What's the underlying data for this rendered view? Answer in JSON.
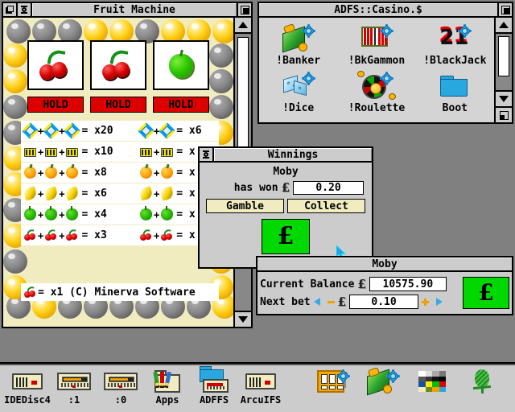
{
  "desktop": {
    "background": "#808080"
  },
  "fruit_machine": {
    "title": "Fruit Machine",
    "reels": [
      {
        "symbol": "cherry"
      },
      {
        "symbol": "cherry"
      },
      {
        "symbol": "apple"
      }
    ],
    "hold_buttons": [
      "HOLD",
      "HOLD",
      "HOLD"
    ],
    "hold_color": "#dd0000",
    "paytable": [
      {
        "symbol": "diamond",
        "three": "= x20",
        "two": "= x6"
      },
      {
        "symbol": "bar",
        "three": "= x10",
        "two": "= x"
      },
      {
        "symbol": "orange",
        "three": "= x8",
        "two": "= x"
      },
      {
        "symbol": "banana",
        "three": "= x6",
        "two": "= x"
      },
      {
        "symbol": "apple",
        "three": "= x4",
        "two": "= x"
      },
      {
        "symbol": "cherry",
        "three": "= x3",
        "two": "= x"
      }
    ],
    "credit_line": "= x1  (C) Minerva Software",
    "bulb_colors": {
      "on": "#ffd21a",
      "off": "#8a8a8a"
    },
    "bulbs_top": [
      "off",
      "off",
      "off",
      "on",
      "on",
      "off",
      "on",
      "on",
      "on"
    ],
    "bulbs_bottom": [
      "off",
      "on",
      "off",
      "off",
      "off",
      "off",
      "off",
      "off",
      "on"
    ],
    "bulbs_left": [
      "on",
      "on",
      "off",
      "off",
      "on",
      "on",
      "off",
      "on",
      "off",
      "on"
    ],
    "bulbs_right": [
      "off",
      "off",
      "off",
      "on",
      "off",
      "off",
      "on",
      "on",
      "on",
      "on"
    ],
    "panel_color": "#f0ecc0"
  },
  "casino": {
    "title": "ADFS::Casino.$",
    "files": [
      {
        "label": "!Banker",
        "icon": "banker-app-icon"
      },
      {
        "label": "!BkGammon",
        "icon": "backgammon-app-icon"
      },
      {
        "label": "!BlackJack",
        "icon": "blackjack-app-icon"
      },
      {
        "label": "!Dice",
        "icon": "dice-app-icon"
      },
      {
        "label": "!Roulette",
        "icon": "roulette-app-icon"
      },
      {
        "label": "Boot",
        "icon": "folder-icon"
      }
    ]
  },
  "winnings": {
    "title": "Winnings",
    "player": "Moby",
    "won_label": "has won",
    "currency": "£",
    "won_value": "0.20",
    "gamble_label": "Gamble",
    "collect_label": "Collect",
    "coin_color": "#00d800"
  },
  "moby": {
    "title": "Moby",
    "balance_label": "Current Balance",
    "currency": "£",
    "balance_value": "10575.90",
    "bet_label": "Next bet",
    "bet_value": "0.10",
    "coin_color": "#00d800"
  },
  "iconbar": {
    "left_items": [
      {
        "label": "IDEDisc4",
        "icon": "harddisc-icon"
      },
      {
        "label": ":1",
        "icon": "floppy-drive-icon"
      },
      {
        "label": ":0",
        "icon": "floppy-drive-icon"
      },
      {
        "label": "Apps",
        "icon": "apps-folder-icon"
      },
      {
        "label": "ADFFS",
        "icon": "adffs-icon"
      },
      {
        "label": "ArcuIFS",
        "icon": "harddisc-icon"
      }
    ],
    "right_items": [
      {
        "label": "",
        "icon": "fruit-machine-icon"
      },
      {
        "label": "",
        "icon": "banker-icon"
      },
      {
        "label": "",
        "icon": "palette-icon"
      },
      {
        "label": "",
        "icon": "acorn-icon"
      }
    ]
  }
}
